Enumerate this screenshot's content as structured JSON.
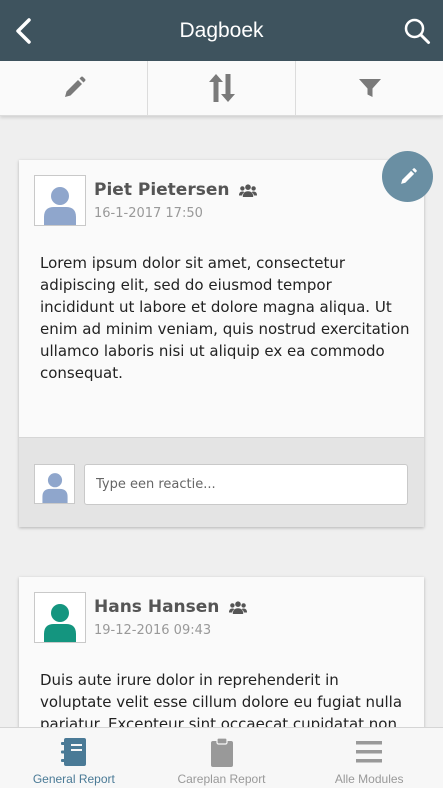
{
  "header": {
    "title": "Dagboek"
  },
  "toolbar": {
    "items": [
      {
        "icon": "pencil-icon"
      },
      {
        "icon": "sort-icon"
      },
      {
        "icon": "filter-icon"
      }
    ]
  },
  "posts": [
    {
      "author": "Piet Pietersen",
      "date": "16-1-2017 17:50",
      "body": "Lorem ipsum dolor sit amet, consectetur adipiscing elit, sed do eiusmod tempor incididunt ut labore et dolore magna aliqua. Ut enim ad minim veniam, quis nostrud exercitation ullamco laboris nisi ut aliquip ex ea commodo consequat.",
      "avatar_color": "#8fa6cc",
      "reply_placeholder": "Type een reactie..."
    },
    {
      "author": "Hans Hansen",
      "date": "19-12-2016 09:43",
      "body": "Duis aute irure dolor in reprehenderit in voluptate velit esse cillum dolore eu fugiat nulla pariatur. Excepteur sint occaecat cupidatat non",
      "avatar_color": "#14957f"
    }
  ],
  "tabbar": {
    "tabs": [
      {
        "label": "General Report",
        "icon": "notebook-icon",
        "active": true
      },
      {
        "label": "Careplan Report",
        "icon": "clipboard-icon",
        "active": false
      },
      {
        "label": "Alle Modules",
        "icon": "menu-icon",
        "active": false
      }
    ]
  },
  "colors": {
    "header_bg": "#3e535e",
    "accent": "#4a7a96",
    "fab": "#6a8fa3"
  }
}
